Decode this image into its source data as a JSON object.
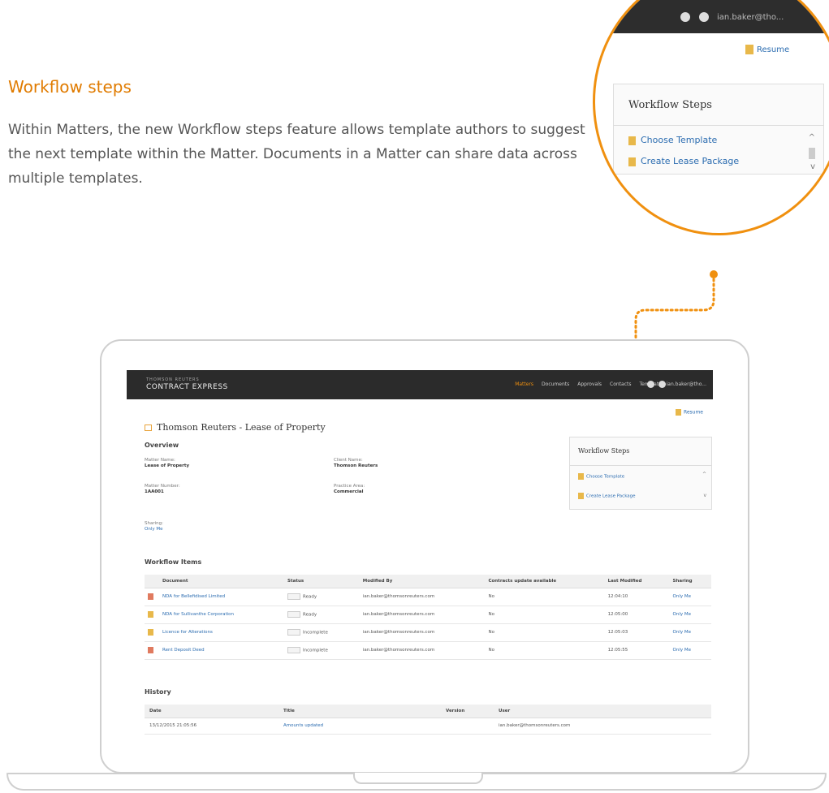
{
  "hero": {
    "title": "Workflow steps",
    "description": "Within Matters, the new Workflow steps feature allows template authors to suggest the next template within the Matter. Documents in a Matter can share data across multiple templates."
  },
  "zoom": {
    "resume_label": "Resume",
    "panel_title": "Workflow Steps",
    "items": [
      "Choose Template",
      "Create Lease Package"
    ],
    "scroll_up": "^",
    "scroll_down": "v"
  },
  "app": {
    "brand_small": "THOMSON REUTERS",
    "brand": "CONTRACT EXPRESS",
    "nav": [
      "Matters",
      "Documents",
      "Approvals",
      "Contacts",
      "Templates"
    ],
    "active_nav": "Matters",
    "user": "ian.baker@tho...",
    "resume_label": "Resume",
    "page_title": "Thomson Reuters - Lease of Property",
    "overview_heading": "Overview",
    "fields": {
      "matter_name_label": "Matter Name:",
      "matter_name": "Lease of Property",
      "client_name_label": "Client Name:",
      "client_name": "Thomson Reuters",
      "matter_number_label": "Matter Number:",
      "matter_number": "1AA001",
      "practice_area_label": "Practice Area:",
      "practice_area": "Commercial",
      "sharing_label": "Sharing:",
      "sharing": "Only Me"
    },
    "workflow_steps": {
      "title": "Workflow Steps",
      "items": [
        "Choose Template",
        "Create Lease Package"
      ]
    },
    "workflow_items_heading": "Workflow Items",
    "items_columns": [
      "Document",
      "Status",
      "Modified By",
      "Contracts update available",
      "Last Modified",
      "Sharing"
    ],
    "items_rows": [
      {
        "doc": "NDA for Bellefidised Limited",
        "status": "Ready",
        "by": "ian.baker@thomsonreuters.com",
        "update": "No",
        "modified": "12:04:10",
        "sharing": "Only Me"
      },
      {
        "doc": "NDA for Sullivanthe Corporation",
        "status": "Ready",
        "by": "ian.baker@thomsonreuters.com",
        "update": "No",
        "modified": "12:05:00",
        "sharing": "Only Me"
      },
      {
        "doc": "Licence for Alterations",
        "status": "Incomplete",
        "by": "ian.baker@thomsonreuters.com",
        "update": "No",
        "modified": "12:05:03",
        "sharing": "Only Me"
      },
      {
        "doc": "Rent Deposit Deed",
        "status": "Incomplete",
        "by": "ian.baker@thomsonreuters.com",
        "update": "No",
        "modified": "12:05:55",
        "sharing": "Only Me"
      }
    ],
    "history_heading": "History",
    "history_columns": [
      "Date",
      "Title",
      "Version",
      "User"
    ],
    "history_rows": [
      {
        "date": "13/12/2015 21:05:56",
        "title": "Amounts updated",
        "version": "",
        "user": "ian.baker@thomsonreuters.com"
      }
    ]
  },
  "colors": {
    "accent": "#f0900f",
    "title_orange": "#e07b00",
    "link_blue": "#2b6cb0",
    "appbar": "#2b2b2b"
  }
}
